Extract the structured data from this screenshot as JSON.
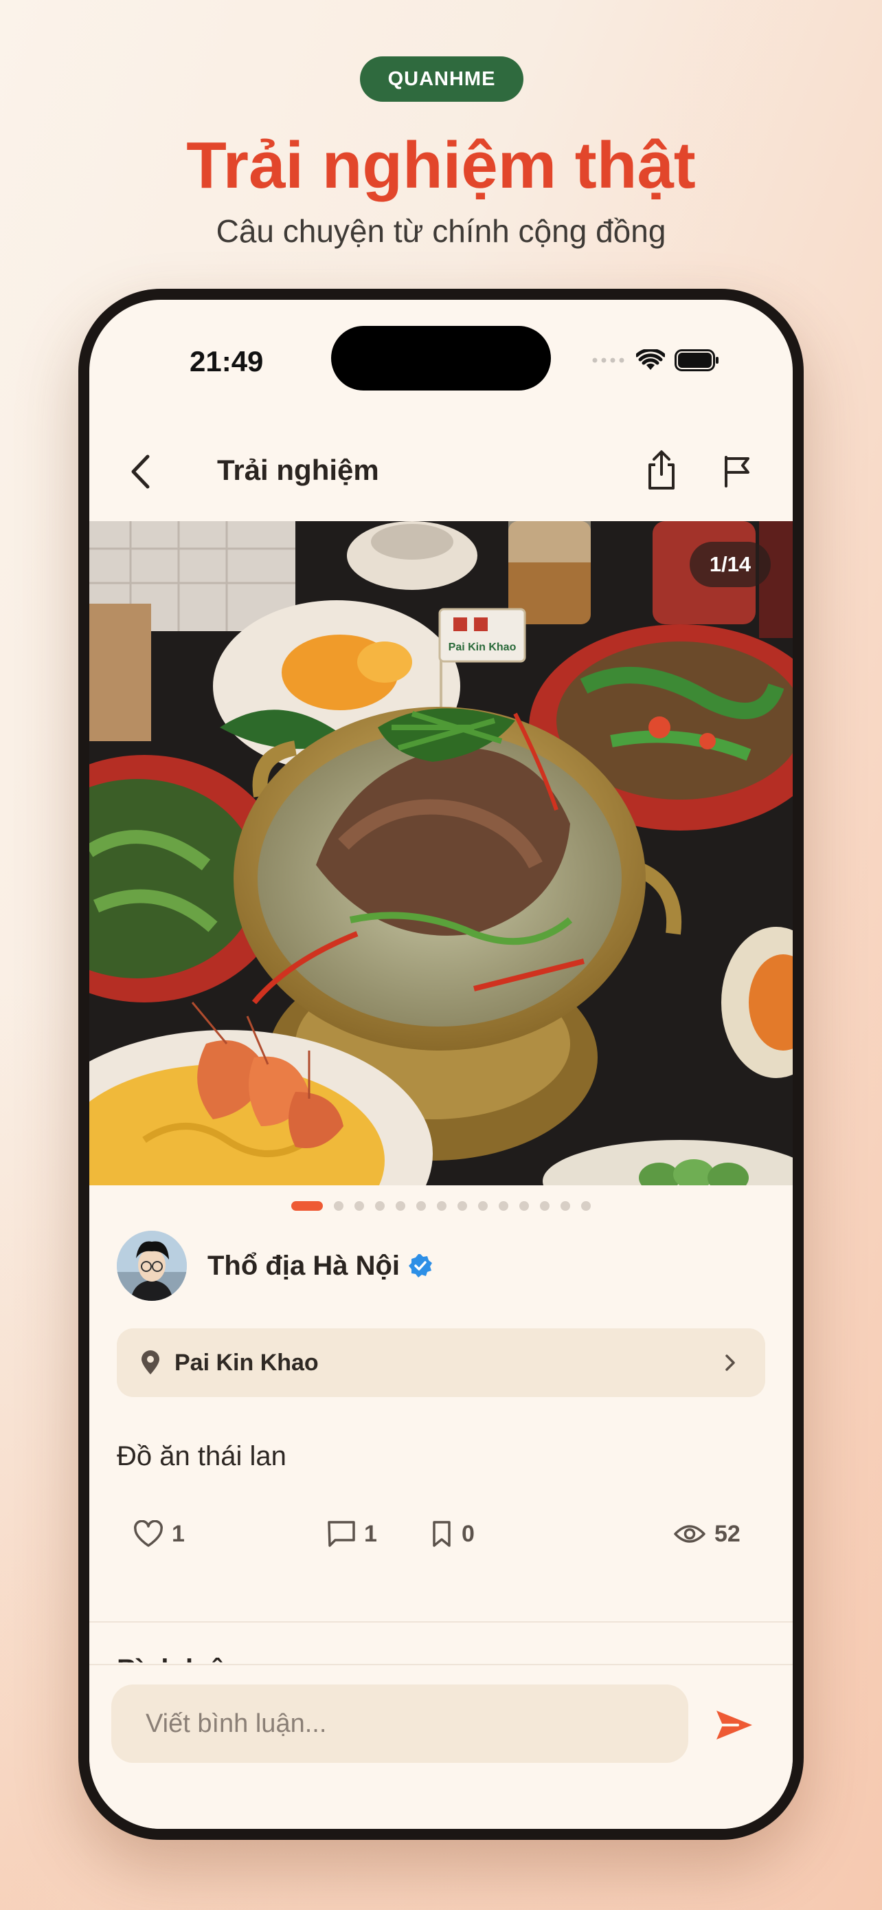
{
  "promo": {
    "badge": "QUANHME",
    "headline": "Trải nghiệm thật",
    "subheadline": "Câu chuyện từ chính cộng đồng"
  },
  "status_bar": {
    "time": "21:49",
    "icons": [
      "signal-dots-icon",
      "wifi-icon",
      "battery-icon"
    ]
  },
  "nav": {
    "title": "Trải nghiệm",
    "back_icon": "chevron-left-icon",
    "share_icon": "share-icon",
    "report_icon": "flag-icon"
  },
  "gallery": {
    "counter": "1/14",
    "total": 14,
    "current": 1,
    "restaurant_sign": "Pai Kin Khao"
  },
  "author": {
    "name": "Thổ địa Hà Nội",
    "verified": true
  },
  "place": {
    "name": "Pai Kin Khao",
    "icon": "location-pin-icon"
  },
  "post": {
    "text": "Đồ ăn thái lan"
  },
  "stats": {
    "likes": "1",
    "comments": "1",
    "saves": "0",
    "views": "52"
  },
  "comments": {
    "title": "Bình luận",
    "placeholder": "Viết bình luận...",
    "send_icon": "send-icon"
  },
  "colors": {
    "accent": "#ee5a34",
    "headline": "#e2462b",
    "badge_bg": "#2f6a3e",
    "screen_bg": "#fdf6ee",
    "chip_bg": "#f4e8d8",
    "verified": "#2d8fe6"
  }
}
